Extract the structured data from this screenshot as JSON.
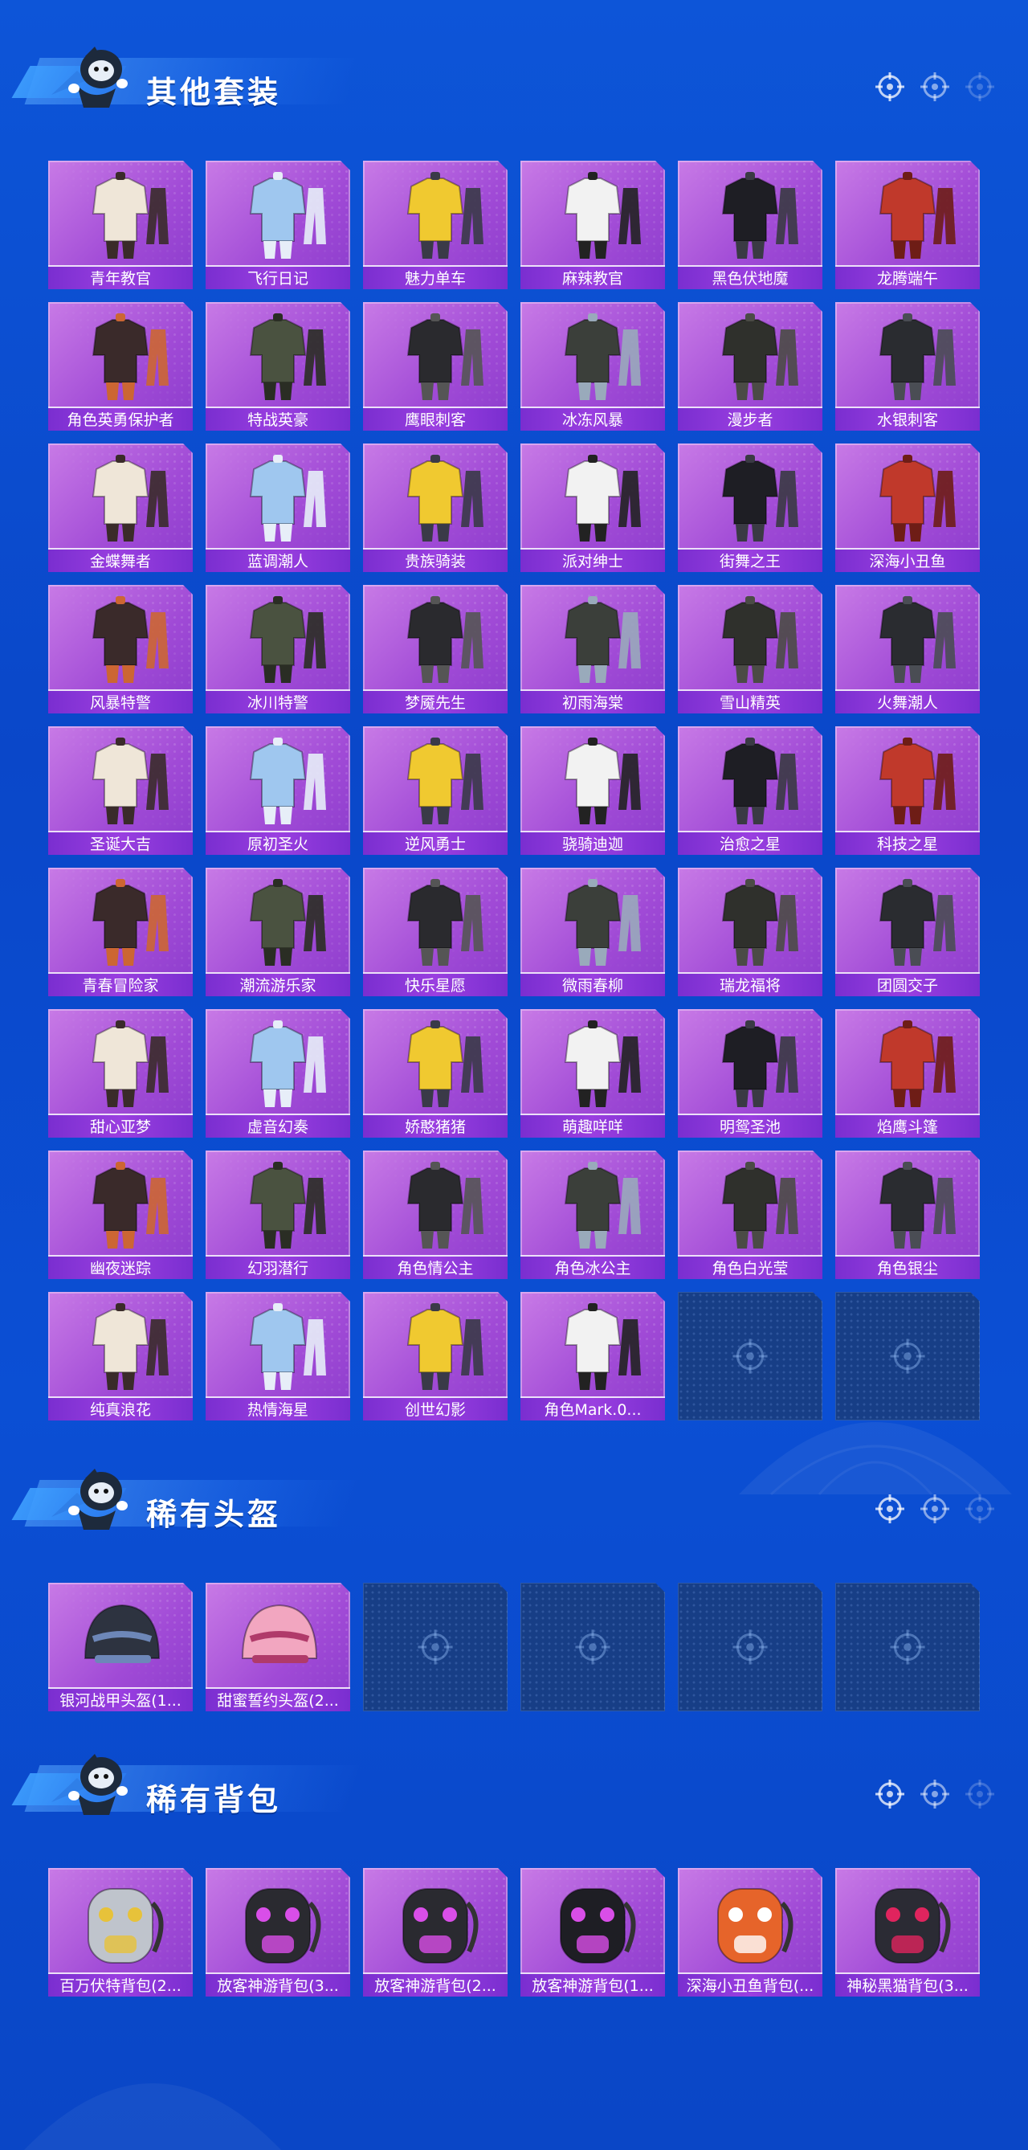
{
  "colors": {
    "background": "#0b4fd4",
    "card": "#a04ad6",
    "label_bar": "#8a36d8",
    "empty_slot": "#173e86"
  },
  "sections": [
    {
      "title": "其他套装",
      "empty_slots": 2,
      "items": [
        {
          "label": "青年教官",
          "icon": "outfit-icon"
        },
        {
          "label": "飞行日记",
          "icon": "outfit-icon"
        },
        {
          "label": "魅力单车",
          "icon": "outfit-icon"
        },
        {
          "label": "麻辣教官",
          "icon": "outfit-icon"
        },
        {
          "label": "黑色伏地魔",
          "icon": "outfit-icon"
        },
        {
          "label": "龙腾端午",
          "icon": "outfit-icon"
        },
        {
          "label": "角色英勇保护者",
          "icon": "outfit-icon"
        },
        {
          "label": "特战英豪",
          "icon": "outfit-icon"
        },
        {
          "label": "鹰眼刺客",
          "icon": "outfit-icon"
        },
        {
          "label": "冰冻风暴",
          "icon": "outfit-icon"
        },
        {
          "label": "漫步者",
          "icon": "outfit-icon"
        },
        {
          "label": "水银刺客",
          "icon": "outfit-icon"
        },
        {
          "label": "金蝶舞者",
          "icon": "outfit-icon"
        },
        {
          "label": "蓝调潮人",
          "icon": "outfit-icon"
        },
        {
          "label": "贵族骑装",
          "icon": "outfit-icon"
        },
        {
          "label": "派对绅士",
          "icon": "outfit-icon"
        },
        {
          "label": "街舞之王",
          "icon": "outfit-icon"
        },
        {
          "label": "深海小丑鱼",
          "icon": "outfit-icon"
        },
        {
          "label": "风暴特警",
          "icon": "outfit-icon"
        },
        {
          "label": "冰川特警",
          "icon": "outfit-icon"
        },
        {
          "label": "梦魇先生",
          "icon": "outfit-icon"
        },
        {
          "label": "初雨海棠",
          "icon": "outfit-icon"
        },
        {
          "label": "雪山精英",
          "icon": "outfit-icon"
        },
        {
          "label": "火舞潮人",
          "icon": "outfit-icon"
        },
        {
          "label": "圣诞大吉",
          "icon": "outfit-icon"
        },
        {
          "label": "原初圣火",
          "icon": "outfit-icon"
        },
        {
          "label": "逆风勇士",
          "icon": "outfit-icon"
        },
        {
          "label": "骁骑迪迦",
          "icon": "outfit-icon"
        },
        {
          "label": "治愈之星",
          "icon": "outfit-icon"
        },
        {
          "label": "科技之星",
          "icon": "outfit-icon"
        },
        {
          "label": "青春冒险家",
          "icon": "outfit-icon"
        },
        {
          "label": "潮流游乐家",
          "icon": "outfit-icon"
        },
        {
          "label": "快乐星愿",
          "icon": "outfit-icon"
        },
        {
          "label": "微雨春柳",
          "icon": "outfit-icon"
        },
        {
          "label": "瑞龙福将",
          "icon": "outfit-icon"
        },
        {
          "label": "团圆交子",
          "icon": "outfit-icon"
        },
        {
          "label": "甜心亚梦",
          "icon": "outfit-icon"
        },
        {
          "label": "虚音幻奏",
          "icon": "outfit-icon"
        },
        {
          "label": "娇憨猪猪",
          "icon": "outfit-icon"
        },
        {
          "label": "萌趣咩咩",
          "icon": "outfit-icon"
        },
        {
          "label": "明鸳圣池",
          "icon": "outfit-icon"
        },
        {
          "label": "焰鹰斗篷",
          "icon": "outfit-icon"
        },
        {
          "label": "幽夜迷踪",
          "icon": "outfit-icon"
        },
        {
          "label": "幻羽潜行",
          "icon": "outfit-icon"
        },
        {
          "label": "角色情公主",
          "icon": "outfit-icon"
        },
        {
          "label": "角色冰公主",
          "icon": "outfit-icon"
        },
        {
          "label": "角色白光莹",
          "icon": "outfit-icon"
        },
        {
          "label": "角色银尘",
          "icon": "outfit-icon"
        },
        {
          "label": "纯真浪花",
          "icon": "outfit-icon"
        },
        {
          "label": "热情海星",
          "icon": "outfit-icon"
        },
        {
          "label": "创世幻影",
          "icon": "outfit-icon"
        },
        {
          "label": "角色Mark.0...",
          "icon": "outfit-icon"
        }
      ]
    },
    {
      "title": "稀有头盔",
      "empty_slots": 4,
      "items": [
        {
          "label": "银河战甲头盔(1...",
          "icon": "helmet-icon"
        },
        {
          "label": "甜蜜誓约头盔(2...",
          "icon": "helmet-icon"
        }
      ]
    },
    {
      "title": "稀有背包",
      "empty_slots": 0,
      "items": [
        {
          "label": "百万伏特背包(2...",
          "icon": "backpack-icon"
        },
        {
          "label": "放客神游背包(3...",
          "icon": "backpack-icon"
        },
        {
          "label": "放客神游背包(2...",
          "icon": "backpack-icon"
        },
        {
          "label": "放客神游背包(1...",
          "icon": "backpack-icon"
        },
        {
          "label": "深海小丑鱼背包(...",
          "icon": "backpack-icon"
        },
        {
          "label": "神秘黑猫背包(3...",
          "icon": "backpack-icon"
        }
      ]
    }
  ]
}
